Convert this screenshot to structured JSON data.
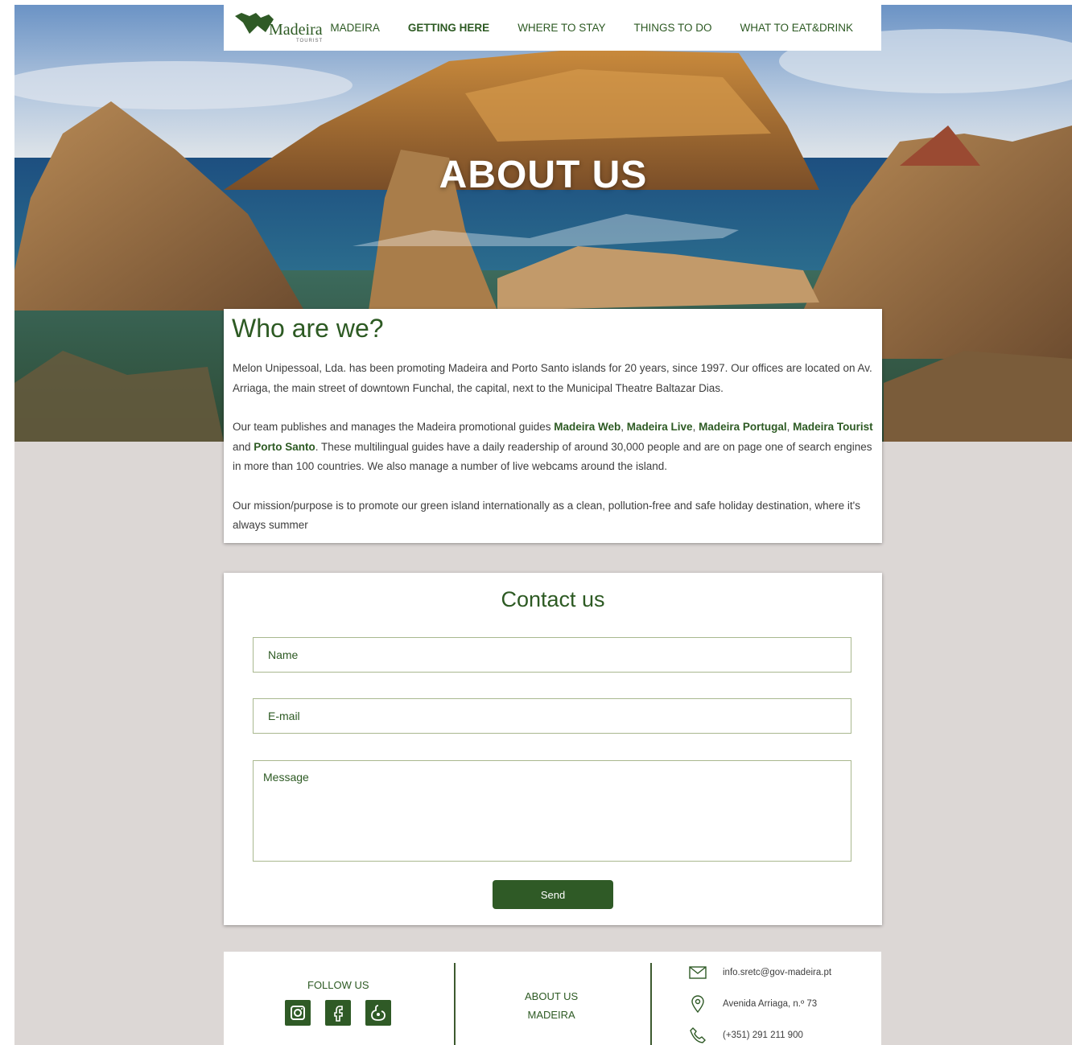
{
  "nav": {
    "logo_text": "Madeira",
    "logo_sub": "TOURIST",
    "items": [
      {
        "label": "MADEIRA",
        "active": false
      },
      {
        "label": "GETTING HERE",
        "active": true
      },
      {
        "label": "WHERE TO STAY",
        "active": false
      },
      {
        "label": "THINGS TO DO",
        "active": false
      },
      {
        "label": "WHAT TO EAT&DRINK",
        "active": false
      }
    ]
  },
  "hero": {
    "title": "ABOUT US"
  },
  "who": {
    "heading": "Who are we?",
    "p1": "Melon Unipessoal, Lda. has been promoting Madeira and Porto Santo islands for 20 years, since 1997. Our offices are located on Av. Arriaga, the main street of downtown Funchal, the capital, next to the Municipal Theatre Baltazar Dias.",
    "p2_intro": "Our team publishes and manages the Madeira promotional guides ",
    "links": [
      "Madeira Web",
      "Madeira Live",
      "Madeira Portugal",
      "Madeira Tourist",
      "Porto Santo"
    ],
    "sep_comma": ", ",
    "sep_and": " and ",
    "p2_rest": ". These multilingual guides have a daily readership of around 30,000 people and are on page one of search engines in more than 100 countries. We also manage a number of live webcams around the island.",
    "p3": "Our mission/purpose is to promote our green island internationally as a clean, pollution-free and safe holiday destination, where it's always summer"
  },
  "contact": {
    "heading": "Contact us",
    "name_placeholder": "Name",
    "email_placeholder": "E-mail",
    "message_placeholder": "Message",
    "send_label": "Send"
  },
  "footer": {
    "follow_label": "FOLLOW US",
    "social_icons": [
      "instagram-icon",
      "facebook-icon",
      "tripadvisor-icon"
    ],
    "about_link": "ABOUT US",
    "madeira_link": "MADEIRA",
    "email": "info.sretc@gov-madeira.pt",
    "address": "Avenida Arriaga, n.º 73",
    "phone": "(+351) 291 211 900"
  },
  "colors": {
    "brand_green": "#2f5a26",
    "page_bg": "#dcd7d5"
  }
}
